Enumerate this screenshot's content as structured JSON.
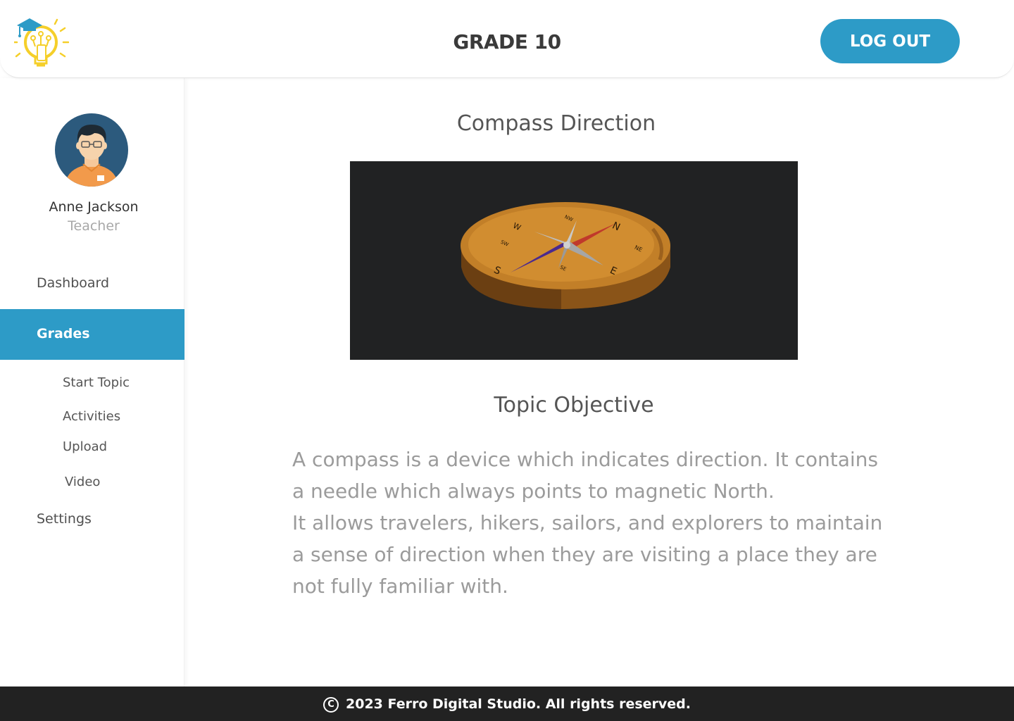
{
  "header": {
    "title": "GRADE 10",
    "logout_label": "LOG OUT"
  },
  "user": {
    "name": "Anne Jackson",
    "role": "Teacher"
  },
  "sidebar": {
    "items": [
      {
        "label": "Dashboard"
      },
      {
        "label": "Grades",
        "active": true
      },
      {
        "label": "Settings"
      }
    ],
    "sub_items": [
      {
        "label": "Start Topic"
      },
      {
        "label": "Activities"
      },
      {
        "label": "Upload"
      },
      {
        "label": "Video"
      }
    ]
  },
  "main": {
    "topic_title": "Compass Direction",
    "objective_title": "Topic Objective",
    "objective_paragraphs": [
      "A compass is a device which indicates direction. It contains a needle which always points to magnetic North.",
      "It allows travelers, hikers, sailors, and explorers to maintain a sense of direction when they are visiting a place they are not fully familiar with."
    ],
    "compass_labels": {
      "n": "N",
      "s": "S",
      "e": "E",
      "w": "W",
      "ne": "NE",
      "nw": "NW",
      "se": "SE",
      "sw": "SW"
    }
  },
  "footer": {
    "copyright_symbol": "C",
    "text": "2023 Ferro Digital Studio. All rights reserved."
  },
  "colors": {
    "accent": "#2d9bc7",
    "footer_bg": "#222222",
    "media_bg": "#212223"
  },
  "icons": {
    "logo": "lightbulb-graduation-logo-icon",
    "avatar": "teacher-avatar-icon",
    "copyright": "copyright-icon"
  }
}
